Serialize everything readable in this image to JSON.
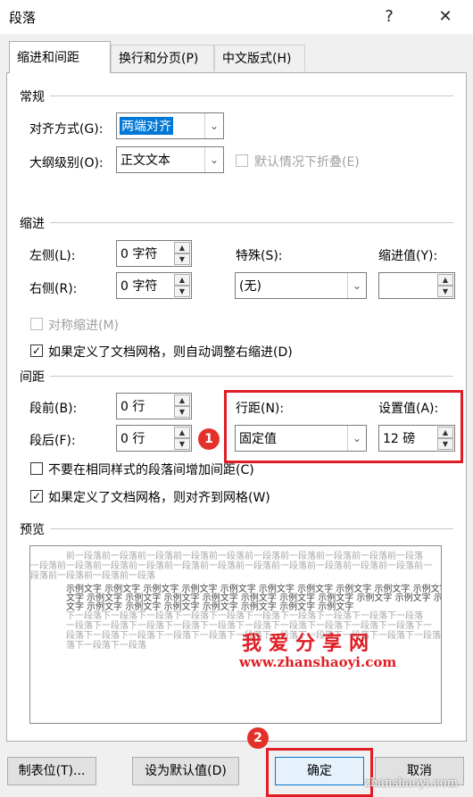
{
  "window": {
    "title": "段落",
    "help": "?",
    "close": "✕"
  },
  "tabs": [
    {
      "label": "缩进和间距",
      "active": true
    },
    {
      "label": "换行和分页(P)"
    },
    {
      "label": "中文版式(H)"
    }
  ],
  "general": {
    "heading": "常规",
    "alignment_label": "对齐方式(G):",
    "alignment_value": "两端对齐",
    "outline_label": "大纲级别(O):",
    "outline_value": "正文文本",
    "collapse_label": "默认情况下折叠(E)"
  },
  "indent": {
    "heading": "缩进",
    "left_label": "左侧(L):",
    "left_value": "0 字符",
    "right_label": "右侧(R):",
    "right_value": "0 字符",
    "special_label": "特殊(S):",
    "special_value": "(无)",
    "indent_value_label": "缩进值(Y):",
    "indent_value": "",
    "mirror_label": "对称缩进(M)",
    "auto_adjust_label": "如果定义了文档网格，则自动调整右缩进(D)",
    "auto_adjust_checked": true
  },
  "spacing": {
    "heading": "间距",
    "before_label": "段前(B):",
    "before_value": "0 行",
    "after_label": "段后(F):",
    "after_value": "0 行",
    "line_spacing_label": "行距(N):",
    "line_spacing_value": "固定值",
    "at_label": "设置值(A):",
    "at_value": "12 磅",
    "no_space_label": "不要在相同样式的段落间增加间距(C)",
    "snap_grid_label": "如果定义了文档网格，则对齐到网格(W)",
    "snap_grid_checked": true
  },
  "preview": {
    "heading": "预览",
    "prev_para": [
      "前一段落前一段落前一段落前一段落前一段落前一段落前一段落前一段落前一段落前一段落",
      "一段落前一段落前一段落前一段落前一段落前一段落前一段落前一段落前一段落前一段落前一段落前一",
      "段落前一段落前一段落前一段落"
    ],
    "sample": [
      "示例文字 示例文字 示例文字 示例文字 示例文字 示例文字 示例文字 示例文字 示例文字 示例文字",
      "文字 示例文字 示例文字 示例文字 示例文字 示例文字 示例文字 示例文字 示例文字 示例文字 示例",
      "文字 示例文字 示例文字 示例文字 示例文字 示例文字 示例文字 示例文字"
    ],
    "next_para": [
      "下一段落下一段落下一段落下一段落下一段落下一段落下一段落下一段落下一段落下一段落",
      "一段落下一段落下一段落下一段落下一段落下一段落下一段落下一段落下一段落下一段落下一",
      "段落下一段落下一段落下一段落下一段落下一段落下一段落下一段落下一段落下一段落下一段落下",
      "落下一段落下一段落"
    ],
    "watermark_title": "我爱分享网",
    "watermark_url": "www.zhanshaoyi.com"
  },
  "buttons": {
    "tabs": "制表位(T)...",
    "set_default": "设为默认值(D)",
    "ok": "确定",
    "cancel": "取消"
  },
  "annotations": {
    "badge1": "1",
    "badge2": "2",
    "corner_watermark": "zhanshaoyi.com"
  },
  "colors": {
    "highlight": "#e01d25",
    "selection": "#0078d7"
  }
}
